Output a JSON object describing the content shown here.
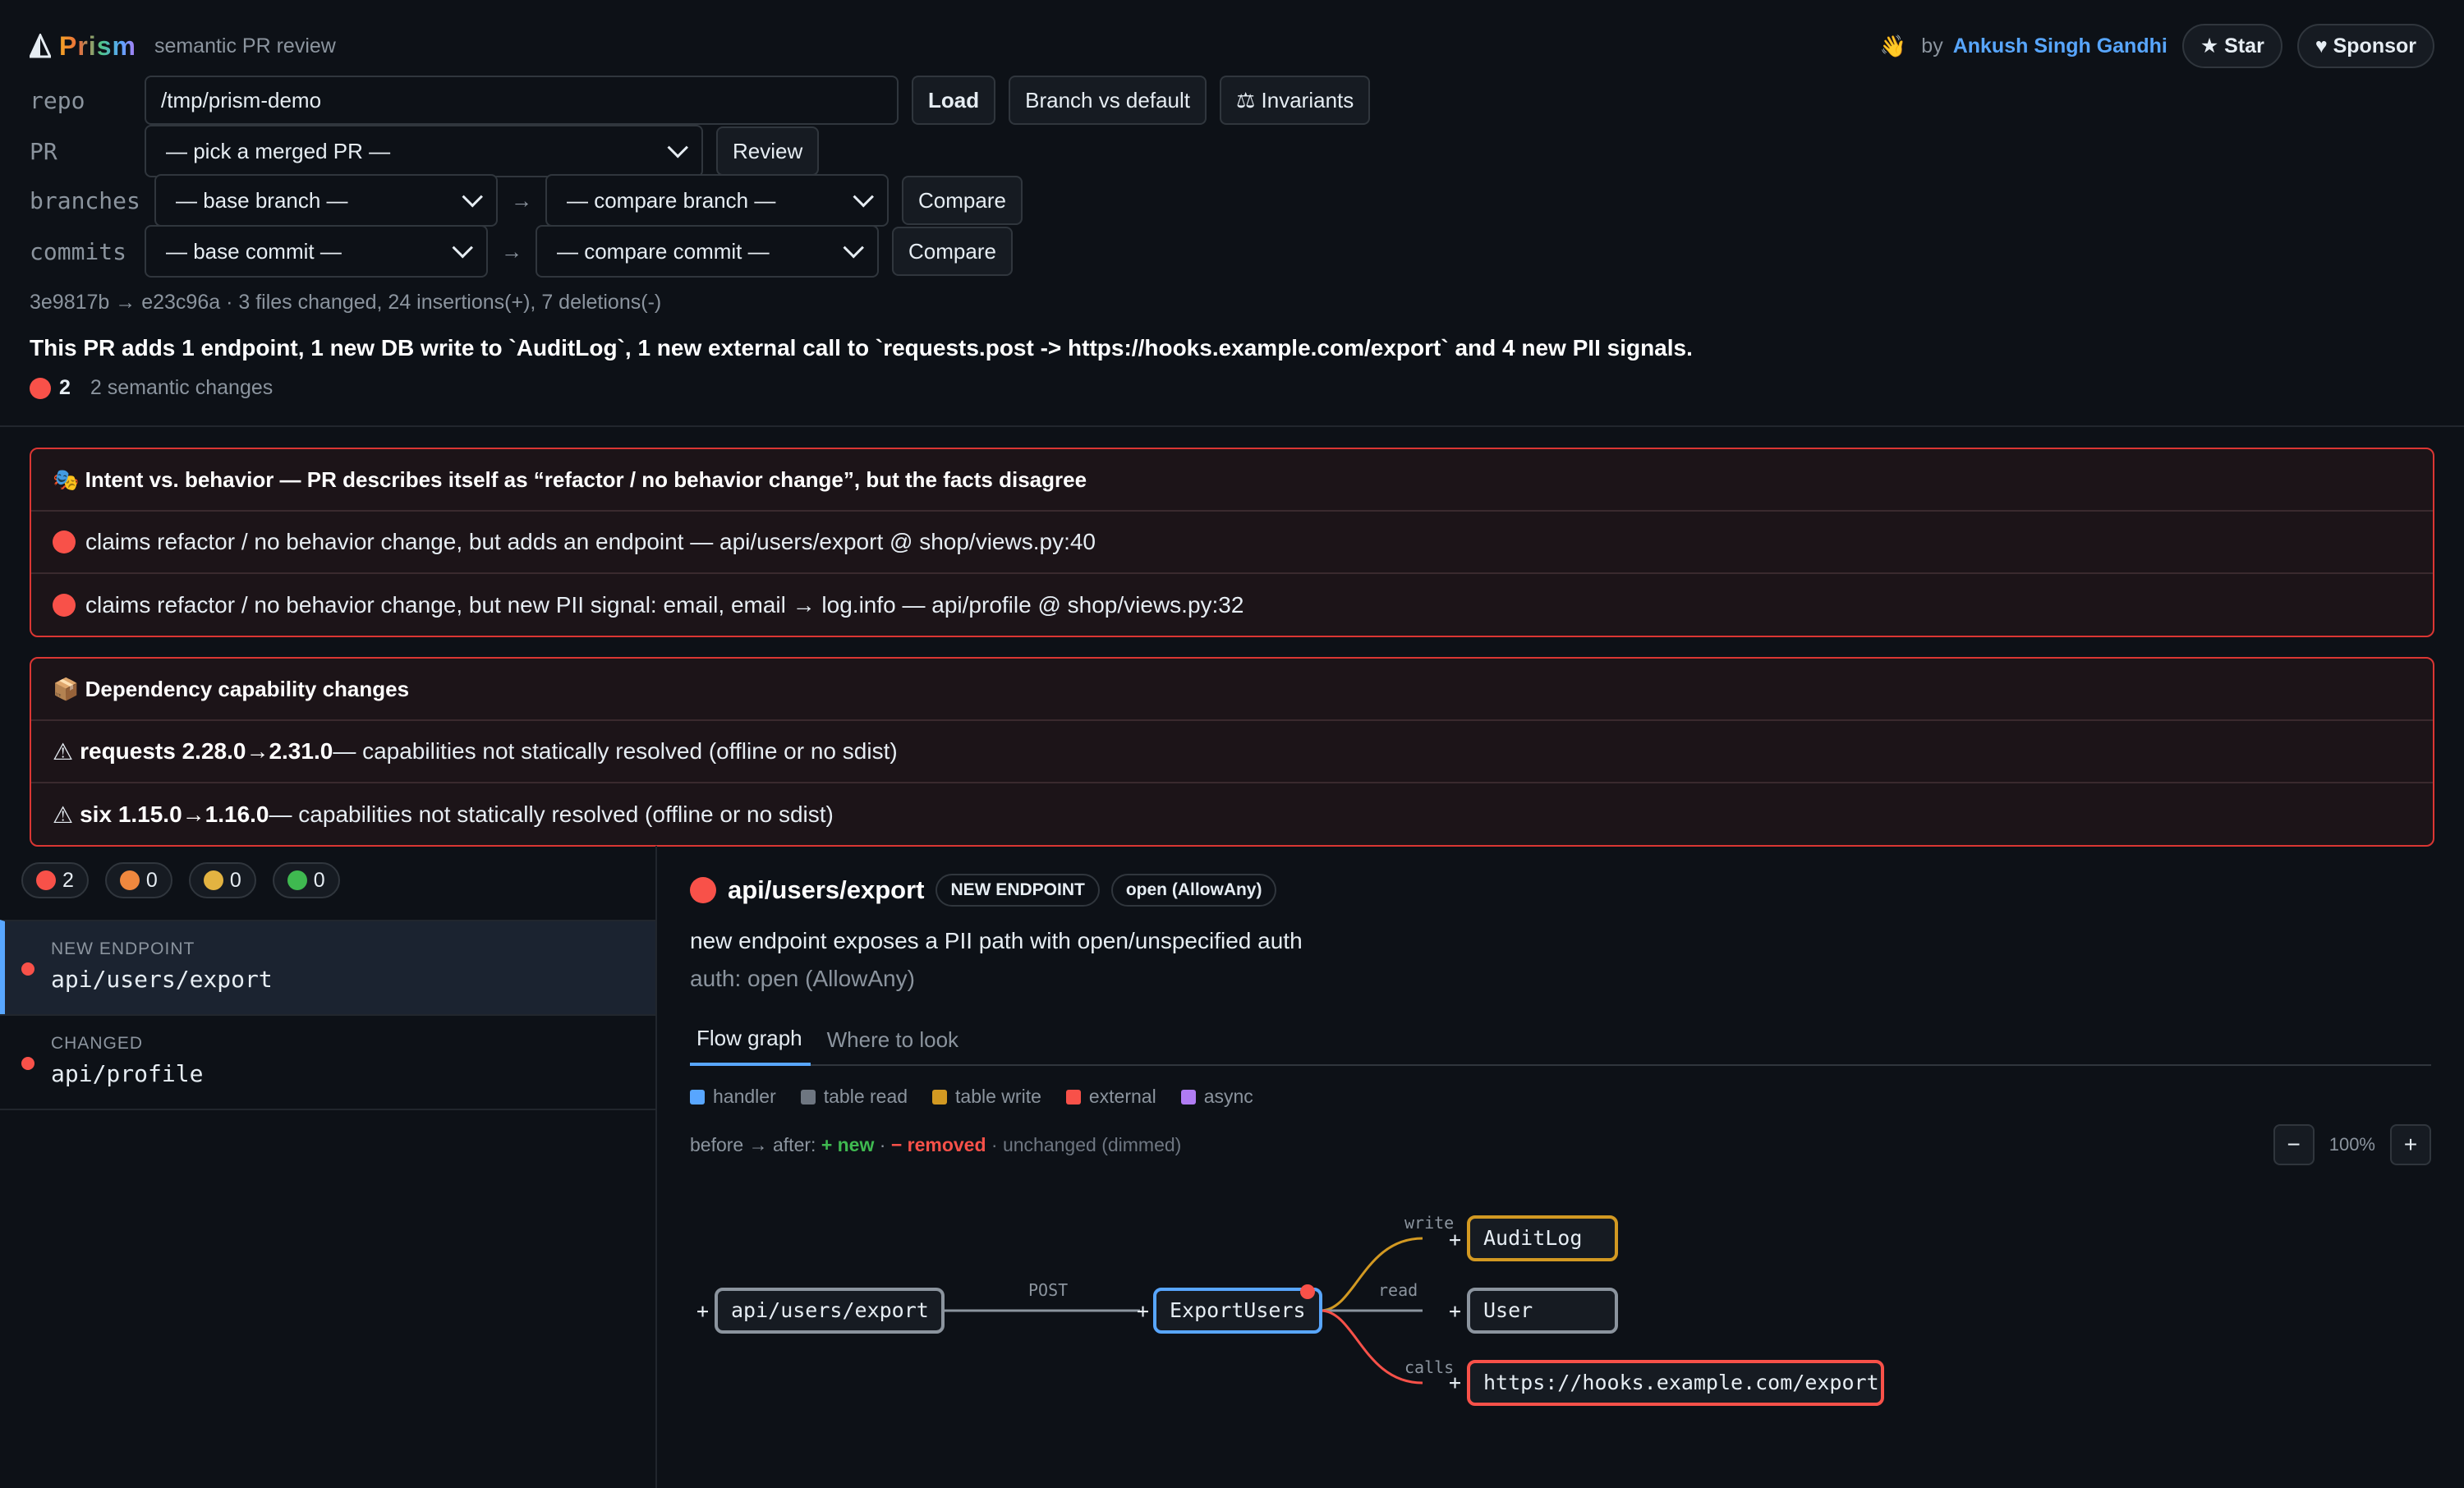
{
  "header": {
    "brand": "Prism",
    "tagline": "semantic PR review",
    "wave": "👋",
    "by": "by",
    "author": "Ankush Singh Gandhi",
    "star": "★ Star",
    "sponsor": "♥ Sponsor"
  },
  "form": {
    "repo_label": "repo",
    "repo_value": "/tmp/prism-demo",
    "load": "Load",
    "branch_vs_default": "Branch vs default",
    "invariants": "⚖ Invariants",
    "pr_label": "PR",
    "pr_select": "— pick a merged PR —",
    "review": "Review",
    "branches_label": "branches",
    "base_branch": "— base branch —",
    "compare_branch": "— compare branch —",
    "compare": "Compare",
    "commits_label": "commits",
    "base_commit": "— base commit —",
    "compare_commit": "— compare commit —",
    "arrow": "→"
  },
  "diffstat": "3e9817b → e23c96a · 3 files changed, 24 insertions(+), 7 deletions(-)",
  "summary": "This PR adds 1 endpoint, 1 new DB write to `AuditLog`, 1 new external call to `requests.post -> https://hooks.example.com/export` and 4 new PII signals.",
  "severity": {
    "count": "2",
    "text": "2 semantic changes"
  },
  "intent_panel": {
    "title": "🎭 Intent vs. behavior — PR describes itself as “refactor / no behavior change”, but the facts disagree",
    "rows": [
      "claims refactor / no behavior change, but adds an endpoint — api/users/export @ shop/views.py:40",
      "claims refactor / no behavior change, but new PII signal: email, email → log.info — api/profile @ shop/views.py:32"
    ]
  },
  "dep_panel": {
    "title": "📦 Dependency capability changes",
    "rows": [
      {
        "pkg": "requests 2.28.0→2.31.0",
        "note": " — capabilities not statically resolved (offline or no sdist)"
      },
      {
        "pkg": "six 1.15.0→1.16.0",
        "note": " — capabilities not statically resolved (offline or no sdist)"
      }
    ]
  },
  "filters": [
    {
      "color": "#f85149",
      "count": "2"
    },
    {
      "color": "#f0883e",
      "count": "0"
    },
    {
      "color": "#e3b341",
      "count": "0"
    },
    {
      "color": "#3fb950",
      "count": "0"
    }
  ],
  "changes": [
    {
      "kind": "NEW ENDPOINT",
      "path": "api/users/export"
    },
    {
      "kind": "CHANGED",
      "path": "api/profile"
    }
  ],
  "detail": {
    "title": "api/users/export",
    "tag1": "NEW ENDPOINT",
    "tag2": "open (AllowAny)",
    "desc": "new endpoint exposes a PII path with open/unspecified auth",
    "auth": "auth: open (AllowAny)",
    "tab_flow": "Flow graph",
    "tab_where": "Where to look",
    "legend": [
      {
        "label": "handler",
        "color": "#58a6ff"
      },
      {
        "label": "table read",
        "color": "#6e7681"
      },
      {
        "label": "table write",
        "color": "#d29922"
      },
      {
        "label": "external",
        "color": "#f85149"
      },
      {
        "label": "async",
        "color": "#b07cf3"
      }
    ],
    "diffkey_prefix": "before → after: ",
    "diffkey_new": "+ new",
    "diffkey_sep": " · ",
    "diffkey_removed": "− removed",
    "diffkey_unchanged": " · unchanged (dimmed)",
    "zoom": "100%",
    "zoom_out": "−",
    "zoom_in": "+"
  },
  "graph": {
    "nodes": {
      "endpoint": "api/users/export",
      "handler": "ExportUsers",
      "auditlog": "AuditLog",
      "user": "User",
      "external": "https://hooks.example.com/export"
    },
    "edges": {
      "post": "POST",
      "write": "write",
      "read": "read",
      "calls": "calls"
    },
    "plus": "+"
  }
}
